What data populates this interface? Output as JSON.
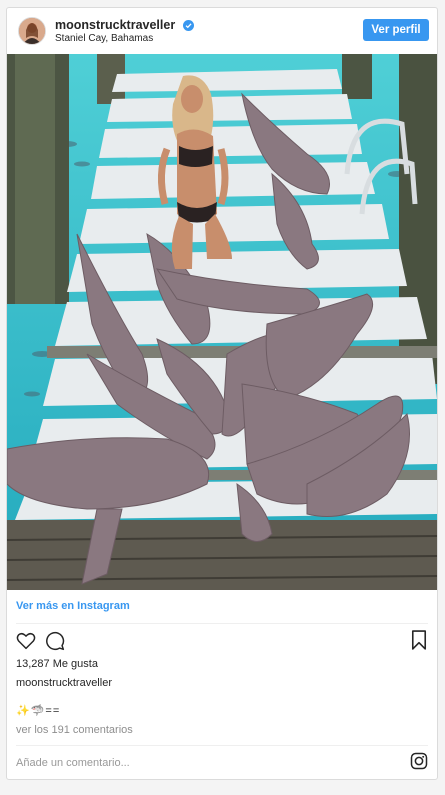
{
  "post": {
    "username": "moonstrucktraveller",
    "location": "Staniel Cay, Bahamas",
    "follow_button": "Ver perfil",
    "see_more": "Ver más en Instagram",
    "likes": "13,287 Me gusta",
    "caption_user": "moonstrucktraveller",
    "caption_text": "✨🦈==",
    "view_comments": "ver los 191 comentarios",
    "comment_placeholder": "Añade un comentario..."
  },
  "colors": {
    "accent": "#3897f0",
    "water": "#2fb6c4",
    "dock": "#e9ecee",
    "shark": "#8c7a80"
  },
  "icons": [
    "verified-badge-icon",
    "heart-icon",
    "comment-icon",
    "bookmark-icon",
    "instagram-icon"
  ]
}
